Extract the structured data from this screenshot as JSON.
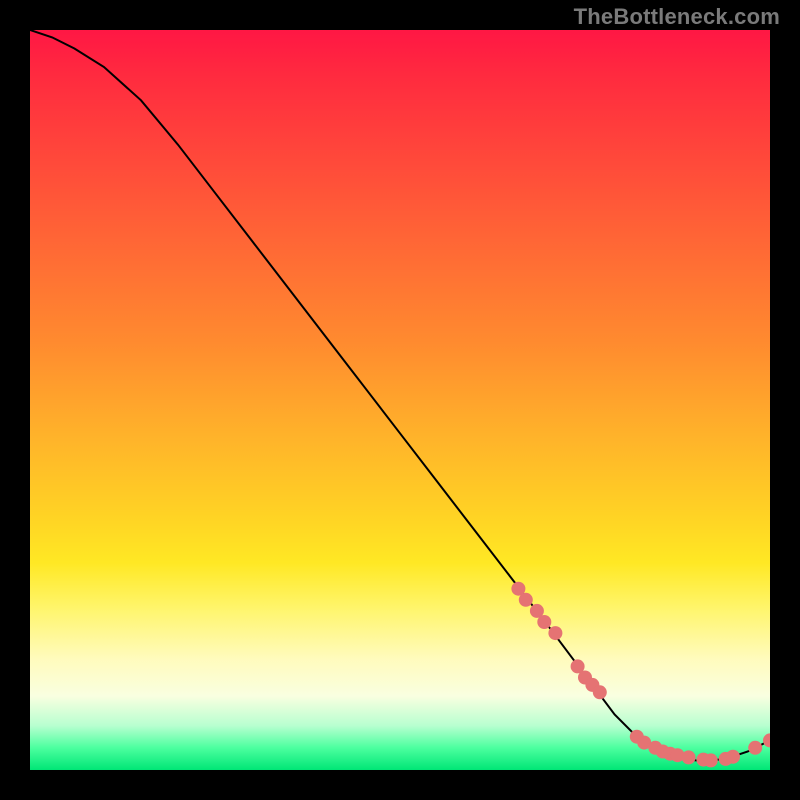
{
  "watermark": "TheBottleneck.com",
  "colors": {
    "bg": "#000000",
    "dot": "#e57373",
    "curve": "#000000",
    "gradient_top": "#ff1744",
    "gradient_bottom": "#00e676"
  },
  "chart_data": {
    "type": "line",
    "title": "",
    "xlabel": "",
    "ylabel": "",
    "xlim": [
      0,
      100
    ],
    "ylim": [
      0,
      100
    ],
    "x": [
      0,
      3,
      6,
      10,
      15,
      20,
      25,
      30,
      35,
      40,
      45,
      50,
      55,
      60,
      65,
      70,
      73,
      76,
      79,
      82,
      85,
      88,
      91,
      94,
      97,
      100
    ],
    "values": [
      100,
      99,
      97.5,
      95,
      90.5,
      84.5,
      78,
      71.5,
      65,
      58.5,
      52,
      45.5,
      39,
      32.5,
      26,
      19.5,
      15.5,
      11.5,
      7.5,
      4.5,
      2.5,
      1.5,
      1.2,
      1.5,
      2.5,
      4
    ],
    "markers": {
      "x": [
        66,
        67,
        68.5,
        69.5,
        71,
        74,
        75,
        76,
        77,
        82,
        83,
        84.5,
        85.5,
        86.5,
        87.5,
        89,
        91,
        92,
        94,
        95,
        98,
        100
      ],
      "y": [
        24.5,
        23,
        21.5,
        20,
        18.5,
        14,
        12.5,
        11.5,
        10.5,
        4.5,
        3.7,
        3.0,
        2.5,
        2.2,
        2.0,
        1.7,
        1.4,
        1.3,
        1.5,
        1.8,
        3.0,
        4.0
      ]
    }
  }
}
